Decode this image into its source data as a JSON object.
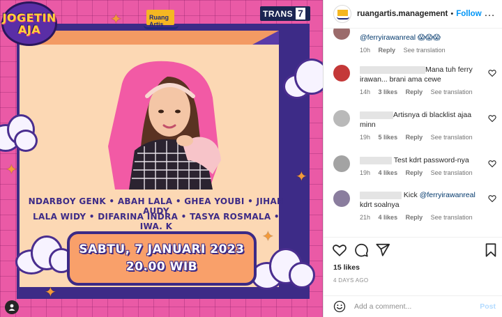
{
  "post_image": {
    "show_logo_line1": "JOGETIN",
    "show_logo_line2": "AJA",
    "ruang_artis_logo": "Ruang Artis",
    "channel_logo_text": "TRΛNS",
    "channel_logo_num": "7",
    "names_line1": "NDARBOY GENK • ABAH LALA • GHEA YOUBI • JIHAN AUDY",
    "names_line2": "LALA WIDY • DIFARINA INDRA • TASYA ROSMALA • IWA. K",
    "date_line": "SABTU, 7 JANUARI 2023",
    "time_line": "20.00 WIB",
    "user_tag_icon": "person-icon"
  },
  "header": {
    "username": "ruangartis.management",
    "separator": "•",
    "follow_label": "Follow",
    "more_icon": "more-horizontal-icon",
    "more_label": "…"
  },
  "comments": [
    {
      "text": "@ferryirawanreal 😱😱😱",
      "mention": "@ferryirawanreal",
      "time": "10h",
      "likes": "",
      "reply": "Reply",
      "translate": "See translation"
    },
    {
      "text": "Mana tuh ferry irawan... brani ama cewe",
      "time": "14h",
      "likes": "3 likes",
      "reply": "Reply",
      "translate": "See translation"
    },
    {
      "text": "Artisnya di blacklist ajaa minn",
      "time": "19h",
      "likes": "5 likes",
      "reply": "Reply",
      "translate": "See translation"
    },
    {
      "text": "Test kdrt password-nya",
      "time": "19h",
      "likes": "4 likes",
      "reply": "Reply",
      "translate": "See translation"
    },
    {
      "text_pre": "Kick ",
      "mention": "@ferryirawanreal",
      "text_post": " kdrt soalnya",
      "time": "21h",
      "likes": "4 likes",
      "reply": "Reply",
      "translate": "See translation"
    }
  ],
  "actions": {
    "like_icon": "heart-icon",
    "comment_icon": "comment-icon",
    "share_icon": "share-icon",
    "save_icon": "bookmark-icon"
  },
  "likes_text": "15 likes",
  "time_ago": "4 DAYS AGO",
  "comment_box": {
    "emoji_icon": "emoji-icon",
    "placeholder": "Add a comment...",
    "post_label": "Post"
  },
  "colors": {
    "accent": "#0095f6",
    "post_disabled": "#b3dbff",
    "bg_pink": "#ea5aa6",
    "frame_purple": "#3d2b87"
  }
}
